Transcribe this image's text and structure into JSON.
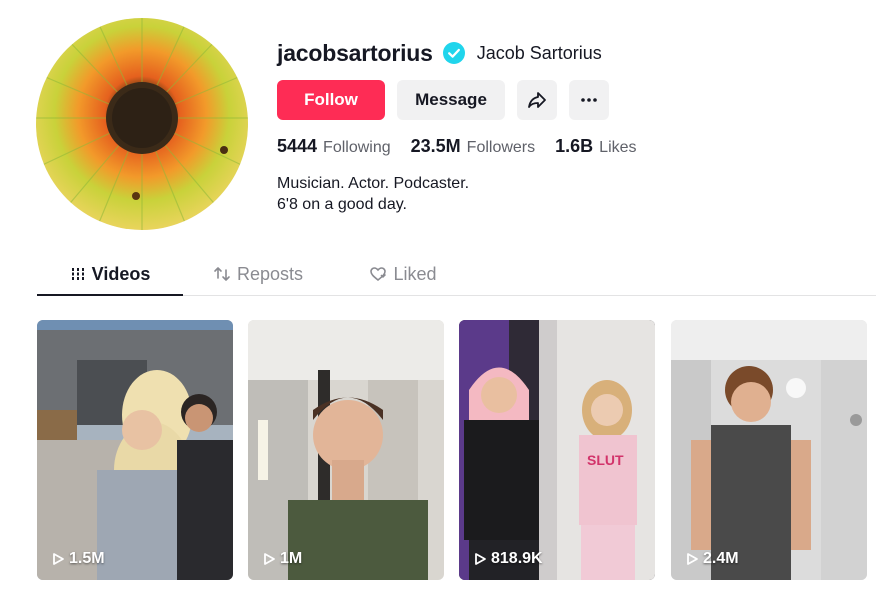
{
  "profile": {
    "username": "jacobsartorius",
    "nickname": "Jacob Sartorius",
    "verified_icon": "verified-badge-icon",
    "avatar_alt": "avatar",
    "bio_line1": "Musician. Actor. Podcaster.",
    "bio_line2": "6'8 on a good day."
  },
  "actions": {
    "follow_label": "Follow",
    "message_label": "Message",
    "share_icon": "share-icon",
    "more_icon": "more-icon"
  },
  "stats": {
    "following_count": "5444",
    "following_label": "Following",
    "followers_count": "23.5M",
    "followers_label": "Followers",
    "likes_count": "1.6B",
    "likes_label": "Likes"
  },
  "tabs": {
    "videos": "Videos",
    "reposts": "Reposts",
    "liked": "Liked"
  },
  "videos": [
    {
      "views": "1.5M"
    },
    {
      "views": "1M"
    },
    {
      "views": "818.9K"
    },
    {
      "views": "2.4M"
    }
  ],
  "colors": {
    "follow": "#fe2c55",
    "verified": "#20d5ec",
    "text": "#161823",
    "muted": "#5f6169"
  }
}
